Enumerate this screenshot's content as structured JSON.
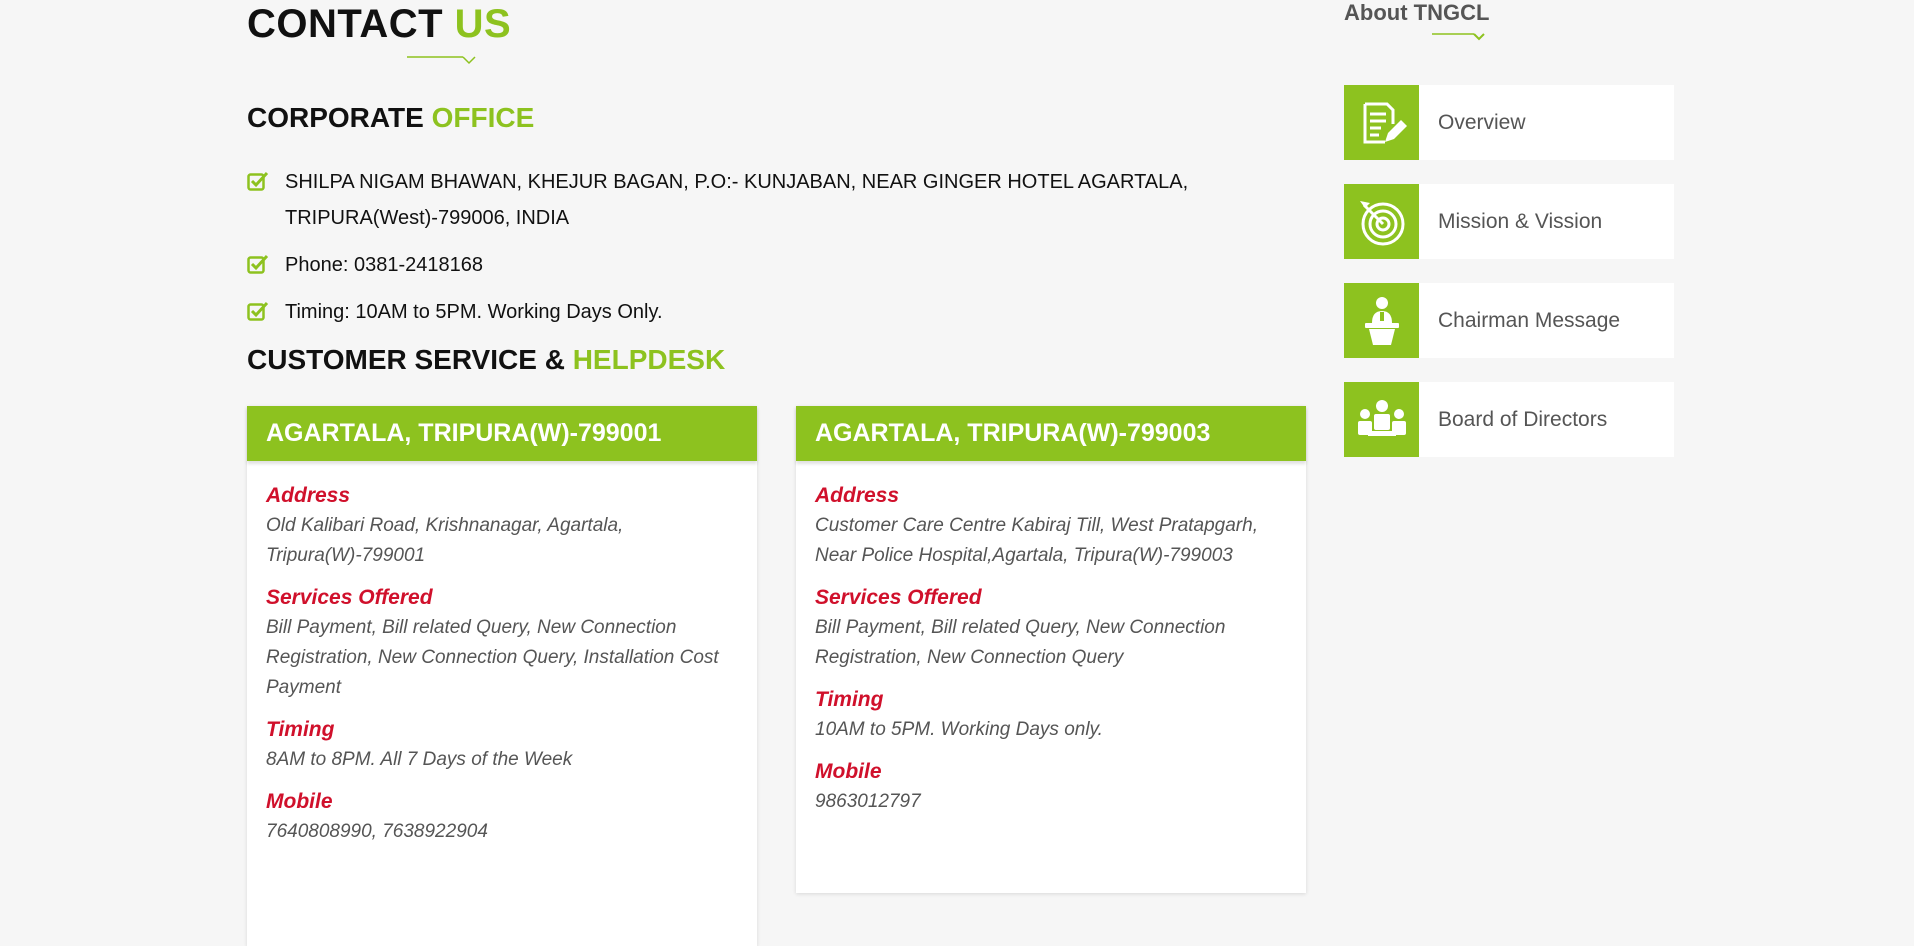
{
  "page_title": {
    "part1": "CONTACT ",
    "part2": "US"
  },
  "corporate": {
    "heading_part1": "CORPORATE ",
    "heading_part2": "OFFICE",
    "items": [
      "SHILPA NIGAM BHAWAN, KHEJUR BAGAN, P.O:- KUNJABAN, NEAR GINGER HOTEL AGARTALA, TRIPURA(West)-799006, INDIA",
      "Phone: 0381-2418168",
      "Timing: 10AM to 5PM. Working Days Only."
    ]
  },
  "helpdesk": {
    "heading_part1": "CUSTOMER SERVICE & ",
    "heading_part2": "HELPDESK",
    "cards": [
      {
        "title": "AGARTALA, TRIPURA(W)-799001",
        "address_label": "Address",
        "address": "Old Kalibari Road, Krishnanagar, Agartala, Tripura(W)-799001",
        "services_label": "Services Offered",
        "services": "Bill Payment, Bill related Query, New Connection Registration, New Connection Query, Installation Cost Payment",
        "timing_label": "Timing",
        "timing": "8AM to 8PM. All 7 Days of the Week",
        "mobile_label": "Mobile",
        "mobile": "7640808990, 7638922904"
      },
      {
        "title": "AGARTALA, TRIPURA(W)-799003",
        "address_label": "Address",
        "address": "Customer Care Centre Kabiraj Till, West Pratapgarh, Near Police Hospital,Agartala, Tripura(W)-799003",
        "services_label": "Services Offered",
        "services": "Bill Payment, Bill related Query, New Connection Registration, New Connection Query",
        "timing_label": "Timing",
        "timing": "10AM to 5PM. Working Days only.",
        "mobile_label": "Mobile",
        "mobile": "9863012797"
      }
    ]
  },
  "sidebar": {
    "title": "About TNGCL",
    "items": [
      {
        "label": "Overview",
        "icon": "document-edit-icon"
      },
      {
        "label": "Mission & Vission",
        "icon": "target-icon"
      },
      {
        "label": "Chairman Message",
        "icon": "speaker-podium-icon"
      },
      {
        "label": "Board of Directors",
        "icon": "board-meeting-icon"
      }
    ]
  },
  "colors": {
    "accent": "#8dc21f",
    "label_red": "#d0102b",
    "background": "#f6f6f6"
  }
}
